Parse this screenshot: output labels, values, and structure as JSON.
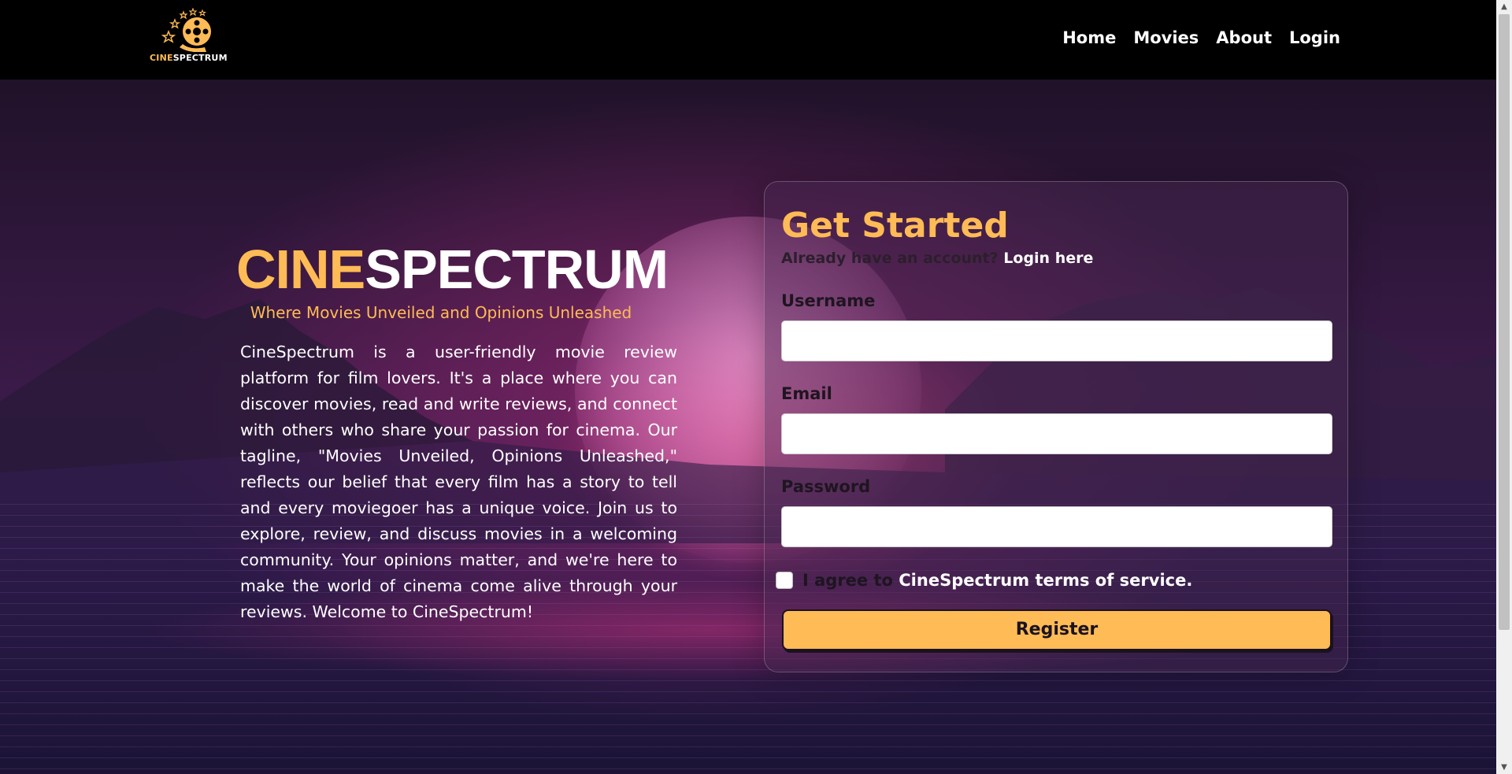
{
  "brand": {
    "logo_part1": "CINE",
    "logo_part2": "SPECTRUM",
    "accent_color": "#ffbb55"
  },
  "nav": {
    "links": [
      "Home",
      "Movies",
      "About",
      "Login"
    ]
  },
  "hero": {
    "title_part1": "CINE",
    "title_part2": "SPECTRUM",
    "tagline": "Where Movies Unveiled and Opinions Unleashed",
    "description": "CineSpectrum is a user-friendly movie review platform for film lovers. It's a place where you can discover movies, read and write reviews, and connect with others who share your passion for cinema. Our tagline, \"Movies Unveiled, Opinions Unleashed,\" reflects our belief that every film has a story to tell and every moviegoer has a unique voice. Join us to explore, review, and discuss movies in a welcoming community. Your opinions matter, and we're here to make the world of cinema come alive through your reviews. Welcome to CineSpectrum!"
  },
  "form": {
    "title": "Get Started",
    "already_text": "Already have an account?",
    "login_link": "Login here",
    "username_label": "Username",
    "username_value": "",
    "email_label": "Email",
    "email_value": "",
    "password_label": "Password",
    "password_value": "",
    "terms_prefix": "I agree to",
    "terms_link": "CineSpectrum terms of service.",
    "terms_checked": false,
    "register_label": "Register"
  },
  "icons": {
    "logo": "film-reel-stars-icon",
    "scroll_up": "triangle-up-icon",
    "scroll_down": "triangle-down-icon"
  }
}
